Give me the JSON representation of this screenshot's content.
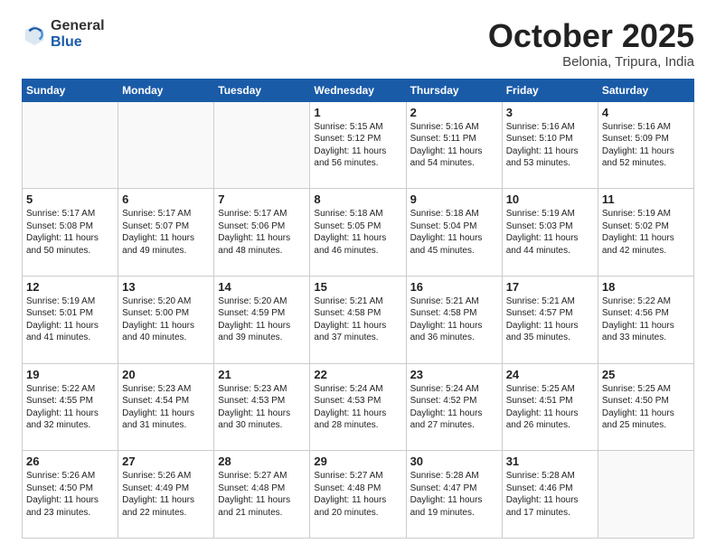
{
  "logo": {
    "general": "General",
    "blue": "Blue"
  },
  "header": {
    "month": "October 2025",
    "location": "Belonia, Tripura, India"
  },
  "weekdays": [
    "Sunday",
    "Monday",
    "Tuesday",
    "Wednesday",
    "Thursday",
    "Friday",
    "Saturday"
  ],
  "weeks": [
    [
      {
        "day": "",
        "info": ""
      },
      {
        "day": "",
        "info": ""
      },
      {
        "day": "",
        "info": ""
      },
      {
        "day": "1",
        "info": "Sunrise: 5:15 AM\nSunset: 5:12 PM\nDaylight: 11 hours\nand 56 minutes."
      },
      {
        "day": "2",
        "info": "Sunrise: 5:16 AM\nSunset: 5:11 PM\nDaylight: 11 hours\nand 54 minutes."
      },
      {
        "day": "3",
        "info": "Sunrise: 5:16 AM\nSunset: 5:10 PM\nDaylight: 11 hours\nand 53 minutes."
      },
      {
        "day": "4",
        "info": "Sunrise: 5:16 AM\nSunset: 5:09 PM\nDaylight: 11 hours\nand 52 minutes."
      }
    ],
    [
      {
        "day": "5",
        "info": "Sunrise: 5:17 AM\nSunset: 5:08 PM\nDaylight: 11 hours\nand 50 minutes."
      },
      {
        "day": "6",
        "info": "Sunrise: 5:17 AM\nSunset: 5:07 PM\nDaylight: 11 hours\nand 49 minutes."
      },
      {
        "day": "7",
        "info": "Sunrise: 5:17 AM\nSunset: 5:06 PM\nDaylight: 11 hours\nand 48 minutes."
      },
      {
        "day": "8",
        "info": "Sunrise: 5:18 AM\nSunset: 5:05 PM\nDaylight: 11 hours\nand 46 minutes."
      },
      {
        "day": "9",
        "info": "Sunrise: 5:18 AM\nSunset: 5:04 PM\nDaylight: 11 hours\nand 45 minutes."
      },
      {
        "day": "10",
        "info": "Sunrise: 5:19 AM\nSunset: 5:03 PM\nDaylight: 11 hours\nand 44 minutes."
      },
      {
        "day": "11",
        "info": "Sunrise: 5:19 AM\nSunset: 5:02 PM\nDaylight: 11 hours\nand 42 minutes."
      }
    ],
    [
      {
        "day": "12",
        "info": "Sunrise: 5:19 AM\nSunset: 5:01 PM\nDaylight: 11 hours\nand 41 minutes."
      },
      {
        "day": "13",
        "info": "Sunrise: 5:20 AM\nSunset: 5:00 PM\nDaylight: 11 hours\nand 40 minutes."
      },
      {
        "day": "14",
        "info": "Sunrise: 5:20 AM\nSunset: 4:59 PM\nDaylight: 11 hours\nand 39 minutes."
      },
      {
        "day": "15",
        "info": "Sunrise: 5:21 AM\nSunset: 4:58 PM\nDaylight: 11 hours\nand 37 minutes."
      },
      {
        "day": "16",
        "info": "Sunrise: 5:21 AM\nSunset: 4:58 PM\nDaylight: 11 hours\nand 36 minutes."
      },
      {
        "day": "17",
        "info": "Sunrise: 5:21 AM\nSunset: 4:57 PM\nDaylight: 11 hours\nand 35 minutes."
      },
      {
        "day": "18",
        "info": "Sunrise: 5:22 AM\nSunset: 4:56 PM\nDaylight: 11 hours\nand 33 minutes."
      }
    ],
    [
      {
        "day": "19",
        "info": "Sunrise: 5:22 AM\nSunset: 4:55 PM\nDaylight: 11 hours\nand 32 minutes."
      },
      {
        "day": "20",
        "info": "Sunrise: 5:23 AM\nSunset: 4:54 PM\nDaylight: 11 hours\nand 31 minutes."
      },
      {
        "day": "21",
        "info": "Sunrise: 5:23 AM\nSunset: 4:53 PM\nDaylight: 11 hours\nand 30 minutes."
      },
      {
        "day": "22",
        "info": "Sunrise: 5:24 AM\nSunset: 4:53 PM\nDaylight: 11 hours\nand 28 minutes."
      },
      {
        "day": "23",
        "info": "Sunrise: 5:24 AM\nSunset: 4:52 PM\nDaylight: 11 hours\nand 27 minutes."
      },
      {
        "day": "24",
        "info": "Sunrise: 5:25 AM\nSunset: 4:51 PM\nDaylight: 11 hours\nand 26 minutes."
      },
      {
        "day": "25",
        "info": "Sunrise: 5:25 AM\nSunset: 4:50 PM\nDaylight: 11 hours\nand 25 minutes."
      }
    ],
    [
      {
        "day": "26",
        "info": "Sunrise: 5:26 AM\nSunset: 4:50 PM\nDaylight: 11 hours\nand 23 minutes."
      },
      {
        "day": "27",
        "info": "Sunrise: 5:26 AM\nSunset: 4:49 PM\nDaylight: 11 hours\nand 22 minutes."
      },
      {
        "day": "28",
        "info": "Sunrise: 5:27 AM\nSunset: 4:48 PM\nDaylight: 11 hours\nand 21 minutes."
      },
      {
        "day": "29",
        "info": "Sunrise: 5:27 AM\nSunset: 4:48 PM\nDaylight: 11 hours\nand 20 minutes."
      },
      {
        "day": "30",
        "info": "Sunrise: 5:28 AM\nSunset: 4:47 PM\nDaylight: 11 hours\nand 19 minutes."
      },
      {
        "day": "31",
        "info": "Sunrise: 5:28 AM\nSunset: 4:46 PM\nDaylight: 11 hours\nand 17 minutes."
      },
      {
        "day": "",
        "info": ""
      }
    ]
  ]
}
